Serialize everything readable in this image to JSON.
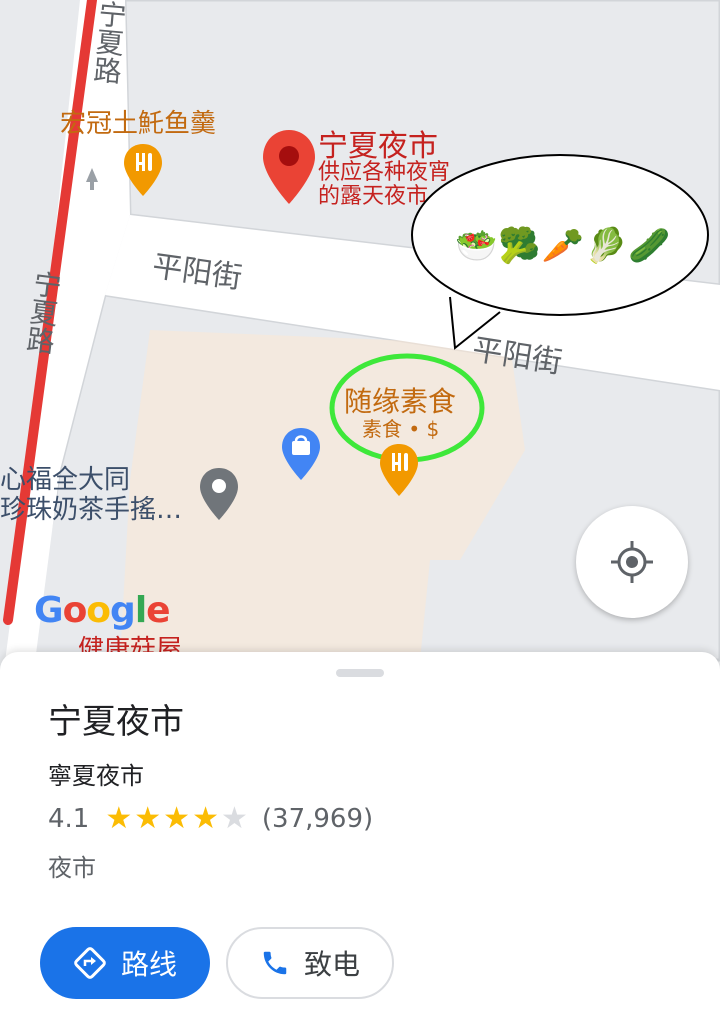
{
  "map": {
    "labels": {
      "road_ningxia_top": "宁夏路",
      "road_ningxia_left": "宁夏路",
      "street_pingyang_1": "平阳街",
      "street_pingyang_2": "平阳街",
      "restaurant_hongguan": "宏冠土魠鱼羹",
      "night_market_name": "宁夏夜市",
      "night_market_desc_line1": "供应各种夜宵",
      "night_market_desc_line2": "的露天夜市",
      "vegetarian_name": "随缘素食",
      "vegetarian_desc": "素食 • $",
      "tea_line1": "心福全大同",
      "tea_line2": "珍珠奶茶手搖…",
      "bottom_partial": "健康菇屋"
    },
    "bubble_emojis": "🥗🥦🥕🥬🥒",
    "google_logo": "Google",
    "colors": {
      "road_red": "#e53935",
      "highlight_green": "#3ee83a",
      "pin_red": "#ea4335",
      "pin_orange": "#f29900",
      "pin_blue": "#4285f4",
      "pin_gray": "#70757a"
    }
  },
  "place": {
    "title": "宁夏夜市",
    "subtitle": "寧夏夜市",
    "rating": "4.1",
    "rating_value": 4.1,
    "stars_total": 5,
    "review_count": "(37,969)",
    "category": "夜市"
  },
  "actions": {
    "route_label": "路线",
    "call_label": "致电"
  }
}
